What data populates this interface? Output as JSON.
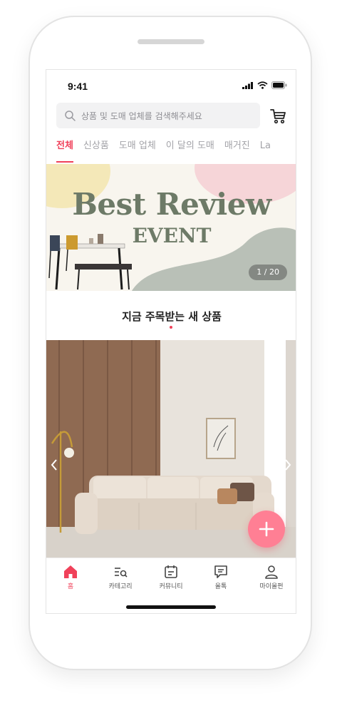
{
  "status_bar": {
    "time": "9:41",
    "signal_icon": "signal-bars-icon",
    "wifi_icon": "wifi-icon",
    "battery_icon": "battery-icon"
  },
  "search": {
    "placeholder": "상품 및 도매 업체를 검색해주세요",
    "icon": "search-icon"
  },
  "cart": {
    "icon": "cart-icon"
  },
  "tabs": [
    {
      "label": "전체",
      "active": true
    },
    {
      "label": "신상품",
      "active": false
    },
    {
      "label": "도매 업체",
      "active": false
    },
    {
      "label": "이 달의 도매",
      "active": false
    },
    {
      "label": "매거진",
      "active": false
    },
    {
      "label": "La",
      "active": false
    }
  ],
  "banner": {
    "title_line1": "Best Review",
    "title_line2": "EVENT",
    "counter": "1 / 20"
  },
  "section": {
    "title": "지금 주목받는 새 상품"
  },
  "fab": {
    "icon": "plus-icon"
  },
  "bottom_nav": [
    {
      "label": "홈",
      "icon": "home-icon",
      "active": true
    },
    {
      "label": "카테고리",
      "icon": "category-icon",
      "active": false
    },
    {
      "label": "커뮤니티",
      "icon": "community-icon",
      "active": false
    },
    {
      "label": "올톡",
      "icon": "chat-icon",
      "active": false
    },
    {
      "label": "마이올펀",
      "icon": "person-icon",
      "active": false
    }
  ],
  "colors": {
    "accent": "#f0415a",
    "fab": "#ff7f94",
    "banner_text": "#6d7a67",
    "banner_bg": "#f8f5ee"
  }
}
